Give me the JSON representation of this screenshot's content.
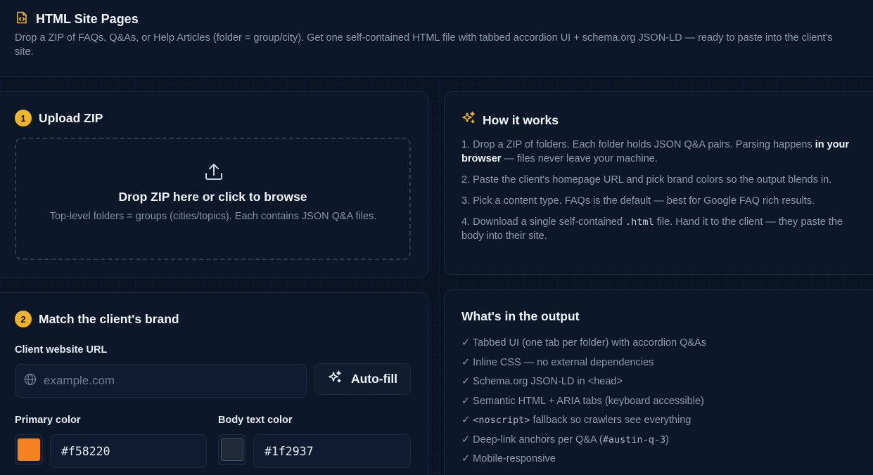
{
  "header": {
    "title": "HTML Site Pages",
    "subtitle": "Drop a ZIP of FAQs, Q&As, or Help Articles (folder = group/city). Get one self-contained HTML file with tabbed accordion UI + schema.org JSON-LD — ready to paste into the client's site."
  },
  "upload": {
    "step": "1",
    "title": "Upload ZIP",
    "drop_title": "Drop ZIP here or click to browse",
    "drop_sub": "Top-level folders = groups (cities/topics). Each contains JSON Q&A files."
  },
  "how": {
    "title": "How it works",
    "items": [
      {
        "pre": "1. Drop a ZIP of folders. Each folder holds JSON Q&A pairs. Parsing happens ",
        "bold": "in your browser",
        "post": " — files never leave your machine."
      },
      {
        "text": "2. Paste the client's homepage URL and pick brand colors so the output blends in."
      },
      {
        "text": "3. Pick a content type. FAQs is the default — best for Google FAQ rich results."
      },
      {
        "pre": "4. Download a single self-contained ",
        "code": ".html",
        "post": " file. Hand it to the client — they paste the body into their site."
      }
    ]
  },
  "brand": {
    "step": "2",
    "title": "Match the client's brand",
    "url_label": "Client website URL",
    "url_placeholder": "example.com",
    "autofill_label": "Auto-fill",
    "primary_label": "Primary color",
    "primary_value": "#f58220",
    "body_label": "Body text color",
    "body_value": "#1f2937"
  },
  "output": {
    "title": "What's in the output",
    "items": [
      {
        "text": "✓ Tabbed UI (one tab per folder) with accordion Q&As"
      },
      {
        "text": "✓ Inline CSS — no external dependencies"
      },
      {
        "text": "✓ Schema.org JSON-LD in <head>"
      },
      {
        "text": "✓ Semantic HTML + ARIA tabs (keyboard accessible)"
      },
      {
        "pre": "✓ ",
        "code": "<noscript>",
        "post": " fallback so crawlers see everything"
      },
      {
        "pre": "✓ Deep-link anchors per Q&A (",
        "code": "#austin-q-3",
        "post": ")"
      },
      {
        "text": "✓ Mobile-responsive"
      }
    ]
  },
  "colors": {
    "accent": "#f0b429",
    "primary_swatch": "#f58220",
    "body_swatch": "#1f2937"
  }
}
